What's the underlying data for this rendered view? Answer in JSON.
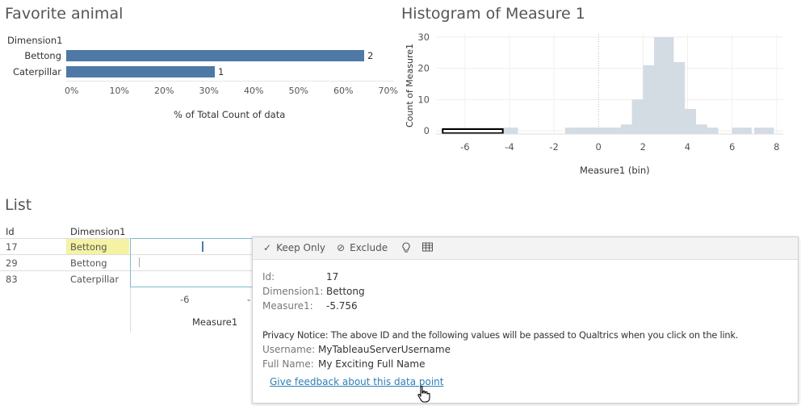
{
  "favorite": {
    "title": "Favorite animal",
    "column_header": "Dimension1",
    "axis_label": "% of Total Count of data",
    "ticks": [
      "0%",
      "10%",
      "20%",
      "30%",
      "40%",
      "50%",
      "60%",
      "70%"
    ]
  },
  "histogram": {
    "title": "Histogram of Measure 1",
    "y_axis_label": "Count of Measure1",
    "x_axis_label": "Measure1 (bin)",
    "y_ticks": [
      "30",
      "20",
      "10",
      "0"
    ],
    "x_ticks": [
      "-6",
      "-4",
      "-2",
      "0",
      "2",
      "4",
      "6",
      "8"
    ]
  },
  "list": {
    "title": "List",
    "col_id": "Id",
    "col_dim": "Dimension1",
    "rows": [
      {
        "id": "17",
        "dim": "Bettong"
      },
      {
        "id": "29",
        "dim": "Bettong"
      },
      {
        "id": "83",
        "dim": "Caterpillar"
      }
    ],
    "x_ticks": [
      "-6",
      "-"
    ],
    "x_axis_label": "Measure1"
  },
  "tooltip": {
    "keep_only": "Keep Only",
    "exclude": "Exclude",
    "keep_only_icon": "check-icon",
    "exclude_icon": "ban-icon",
    "lightbulb_icon": "lightbulb-icon",
    "view_data_icon": "view-data-icon",
    "id_key": "Id:",
    "id_val": "17",
    "dim_key": "Dimension1:",
    "dim_val": "Bettong",
    "measure_key": "Measure1:",
    "measure_val": "-5.756",
    "privacy": "Privacy Notice: The above ID and the following values will be passed to Qualtrics when you click on the link.",
    "user_key": "Username:",
    "user_val": "MyTableauServerUsername",
    "name_key": "Full Name:",
    "name_val": "My Exciting Full Name",
    "link": "Give feedback about this data point"
  },
  "colors": {
    "bar": "#4e79a7",
    "hist": "#d3dbe3",
    "highlight": "#f5f2a3",
    "link": "#2f7fb6"
  },
  "chart_data": [
    {
      "type": "bar",
      "title": "Favorite animal",
      "categories": [
        "Bettong",
        "Caterpillar"
      ],
      "values": [
        66.7,
        33.3
      ],
      "data_labels": [
        "2",
        "1"
      ],
      "xlabel": "% of Total Count of data",
      "ylabel": "Dimension1",
      "xlim": [
        0,
        70
      ],
      "orientation": "horizontal"
    },
    {
      "type": "bar",
      "title": "Histogram of Measure 1",
      "bins": [
        -7,
        -6.5,
        -6,
        -5.5,
        -5,
        -4.5,
        -1.5,
        -1,
        -0.5,
        0,
        0.5,
        1,
        1.5,
        2,
        2.5,
        3,
        3.5,
        4,
        4.5,
        5,
        5.5,
        6,
        6.5,
        7,
        7.5
      ],
      "values": [
        1,
        1,
        1,
        1,
        1,
        1,
        1,
        1,
        1,
        1,
        1,
        2,
        10,
        21,
        30,
        22,
        7,
        2,
        1,
        0,
        0,
        1,
        0,
        1,
        0
      ],
      "bin_width": 0.88,
      "xlabel": "Measure1 (bin)",
      "ylabel": "Count of Measure1",
      "xlim": [
        -7.3,
        8.3
      ],
      "ylim": [
        0,
        30
      ],
      "selected_bin_range": [
        -7,
        -4.3
      ]
    }
  ]
}
